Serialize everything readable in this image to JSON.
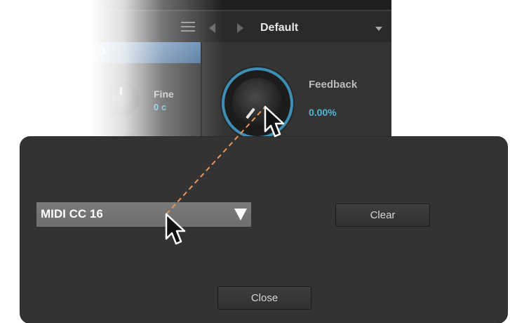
{
  "plugin": {
    "preset_name": "Default",
    "section_label": "D",
    "fine_label": "Fine",
    "fine_value": "0 c",
    "feedback_label": "Feedback",
    "feedback_value": "0.00%",
    "icons": [
      "menu-icon",
      "previous-preset-icon",
      "next-preset-icon",
      "dropdown-caret-icon"
    ]
  },
  "dialog": {
    "midi_select_value": "MIDI CC 16",
    "clear_label": "Clear",
    "close_label": "Close"
  },
  "colors": {
    "accent_blue": "#55b4d6",
    "section_header": "#5f87b2",
    "connector_line": "#e8955a",
    "dialog_bg": "#333333"
  }
}
